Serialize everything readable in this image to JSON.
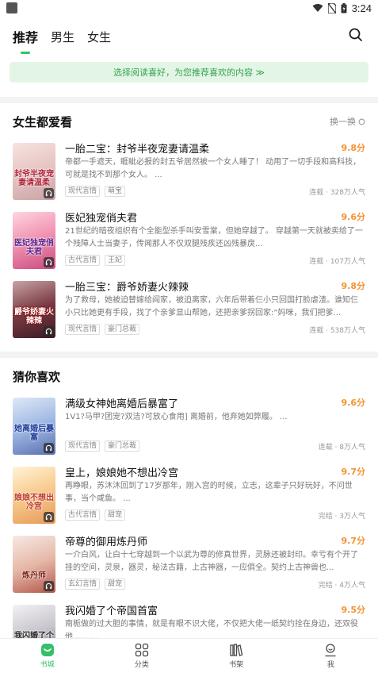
{
  "status_bar": {
    "time": "3:24"
  },
  "tabs": [
    {
      "label": "推荐",
      "active": true
    },
    {
      "label": "男生",
      "active": false
    },
    {
      "label": "女生",
      "active": false
    }
  ],
  "banner": {
    "text": "选择阅读喜好，为您推荐喜欢的内容 ≫"
  },
  "sections": [
    {
      "title": "女生都爱看",
      "action": "换一换",
      "books": [
        {
          "title": "一胎二宝：封爷半夜宠妻请温柔",
          "score": "9.8分",
          "desc": "帝都一手遮天，睚眦必报的封五爷居然被一个女人睡了！ 动用了一切手段和高科技，可就是找不到那个女人。 ...",
          "tags": [
            "现代言情",
            "萌宝"
          ],
          "stat": "连载 · 328万人气",
          "cover_text": "封爷半夜宠妻请温柔"
        },
        {
          "title": "医妃独宠俏夫君",
          "score": "9.6分",
          "desc": "21世纪的暗夜组织有个全能型杀手叫安雪棠，但她穿越了。 穿越第一天就被卖给了一个残障人士当妻子，传闻那人不仅双腿残疾还凶残暴戾...",
          "tags": [
            "古代言情",
            "王妃"
          ],
          "stat": "连载 · 107万人气",
          "cover_text": "医妃独宠俏夫君"
        },
        {
          "title": "一胎三宝：爵爷娇妻火辣辣",
          "score": "9.8分",
          "desc": "为了救母，她被迫替嫁给阎家，被迫离家，六年后带着仨小只回国打脸虐渣。谁知仨小只比她更有手段，找了个亲爹显山帮她，还把亲爹拐回家:“妈咪，我们把爹...",
          "tags": [
            "现代言情",
            "豪门总裁"
          ],
          "stat": "连载 · 538万人气",
          "cover_text": "爵爷娇妻火辣辣"
        }
      ]
    },
    {
      "title": "猜你喜欢",
      "action": "",
      "books": [
        {
          "title": "满级女神她离婚后暴富了",
          "score": "9.6分",
          "desc": "1V1?马甲?团宠?双洁?可放心食用] 离婚前，他弃她如弊履。 ...",
          "tags": [
            "现代言情",
            "豪门总裁"
          ],
          "stat": "连载 · 8万人气",
          "cover_text": "她离婚后暴富"
        },
        {
          "title": "皇上，娘娘她不想出冷宫",
          "score": "9.7分",
          "desc": "再睁眼，苏沐沐回到了17岁那年，刚入宫的时候，立志，这辈子只好玩好，不问世事，当个咸鱼。 ...",
          "tags": [
            "古代言情",
            "甜宠"
          ],
          "stat": "完结 · 3万人气",
          "cover_text": "娘娘不想出冷宫"
        },
        {
          "title": "帝尊的御用炼丹师",
          "score": "9.7分",
          "desc": "一介白风，让白十七穿越到一个以武为尊的修真世界，灵脉还被封印。幸亏有个开了挂的空间，灵泉，器灵，秘法古籍，上古神器，一应俱全。契约上古神兽也...",
          "tags": [
            "玄幻言情",
            "甜宠"
          ],
          "stat": "完结 · 4万人气",
          "cover_text": "炼丹师"
        },
        {
          "title": "我闪婚了个帝国首富",
          "score": "9.5分",
          "desc": "南栀做的过大胆的事情，就是有眼不识大佬，不仅把大佬一纸契约拴在身边，还双役他...... ...",
          "tags": [],
          "stat": "",
          "cover_text": "我闪婚了个帝国首富"
        }
      ]
    }
  ],
  "bottom_nav": [
    {
      "label": "书城",
      "active": true
    },
    {
      "label": "分类",
      "active": false
    },
    {
      "label": "书架",
      "active": false
    },
    {
      "label": "我",
      "active": false
    }
  ],
  "colors": {
    "accent": "#35c069",
    "score": "#f29433",
    "banner_bg": "#e3f6e6",
    "banner_text": "#3aa152"
  }
}
